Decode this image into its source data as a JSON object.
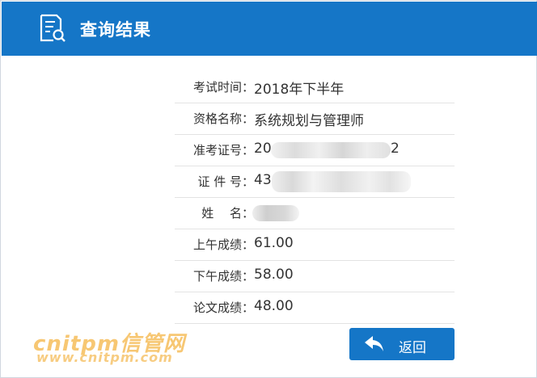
{
  "header": {
    "title": "查询结果",
    "icon": "document-search-icon"
  },
  "results": {
    "rows": [
      {
        "key": "exam-time",
        "label": "考试时间：",
        "value": "2018年下半年"
      },
      {
        "key": "qualification-name",
        "label": "资格名称：",
        "value": "系统规划与管理师"
      },
      {
        "key": "admission-number",
        "label": "准考证号：",
        "value": "20",
        "value_suffix": "2"
      },
      {
        "key": "id-number",
        "label": "证 件 号：",
        "value": "43"
      },
      {
        "key": "name",
        "label": "姓　 名：",
        "value": ""
      },
      {
        "key": "morning-score",
        "label": "上午成绩：",
        "value": "61.00"
      },
      {
        "key": "afternoon-score",
        "label": "下午成绩：",
        "value": "58.00"
      },
      {
        "key": "essay-score",
        "label": "论文成绩：",
        "value": "48.00"
      }
    ]
  },
  "actions": {
    "back_label": "返回",
    "back_icon": "back-arrow-icon"
  },
  "watermark": {
    "brand": "cnitpm信管网",
    "url": "www.cnitpm.com"
  },
  "colors": {
    "accent": "#1576c7",
    "watermark": "#f4b23e"
  }
}
